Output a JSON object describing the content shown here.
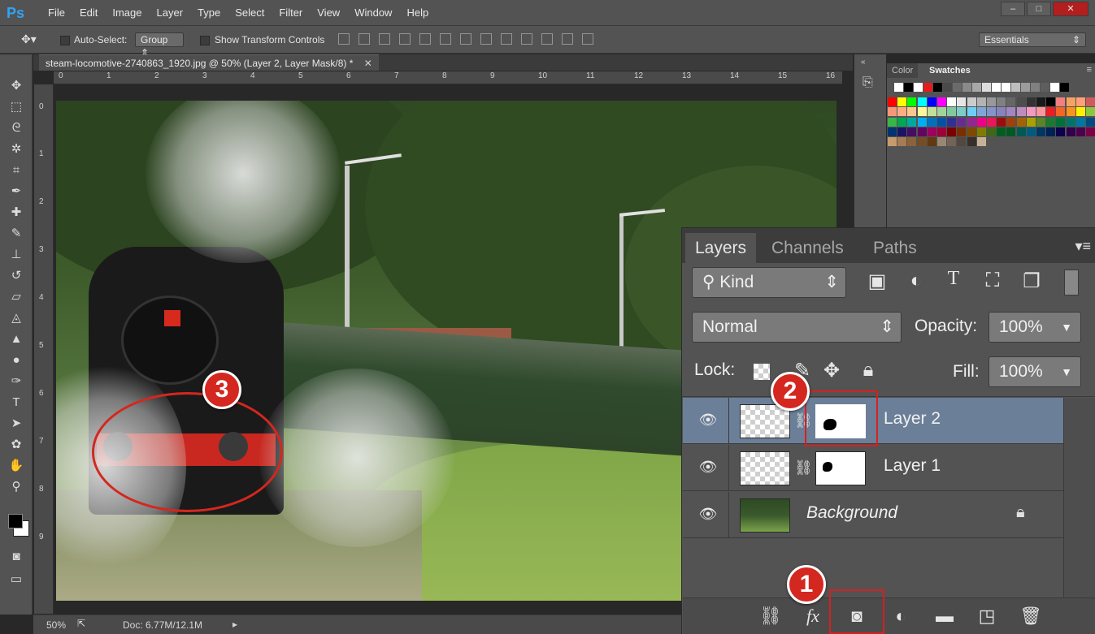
{
  "app": {
    "logo": "Ps",
    "menu": [
      "File",
      "Edit",
      "Image",
      "Layer",
      "Type",
      "Select",
      "Filter",
      "View",
      "Window",
      "Help"
    ],
    "window_controls": [
      "–",
      "□",
      "✕"
    ]
  },
  "options_bar": {
    "auto_select_label": "Auto-Select:",
    "auto_select_value": "Group",
    "transform_label": "Show Transform Controls",
    "workspace": "Essentials"
  },
  "document": {
    "tab_title": "steam-locomotive-2740863_1920.jpg @ 50% (Layer 2, Layer Mask/8) *",
    "ruler_top": [
      "0",
      "1",
      "2",
      "3",
      "4",
      "5",
      "6",
      "7",
      "8",
      "9",
      "10",
      "11",
      "12",
      "13",
      "14",
      "15",
      "16"
    ],
    "ruler_left": [
      "0",
      "1",
      "2",
      "3",
      "4",
      "5",
      "6",
      "7",
      "8",
      "9"
    ],
    "zoom": "50%",
    "doc_size": "Doc: 6.77M/12.1M"
  },
  "swatches_panel": {
    "tabs": [
      "Color",
      "Swatches"
    ],
    "active_tab": "Swatches"
  },
  "layers_panel": {
    "tabs": [
      "Layers",
      "Channels",
      "Paths"
    ],
    "active_tab": "Layers",
    "filter_kind": "Kind",
    "blend_mode": "Normal",
    "opacity_label": "Opacity:",
    "opacity_value": "100%",
    "lock_label": "Lock:",
    "fill_label": "Fill:",
    "fill_value": "100%",
    "layers": [
      {
        "name": "Layer 2",
        "selected": true
      },
      {
        "name": "Layer 1",
        "selected": false
      },
      {
        "name": "Background",
        "selected": false,
        "locked": true
      }
    ]
  },
  "callouts": [
    "1",
    "2",
    "3"
  ],
  "colors": {
    "ui_dark": "#535353",
    "selection": "#6b7f98",
    "callout_red": "#d4271f"
  }
}
